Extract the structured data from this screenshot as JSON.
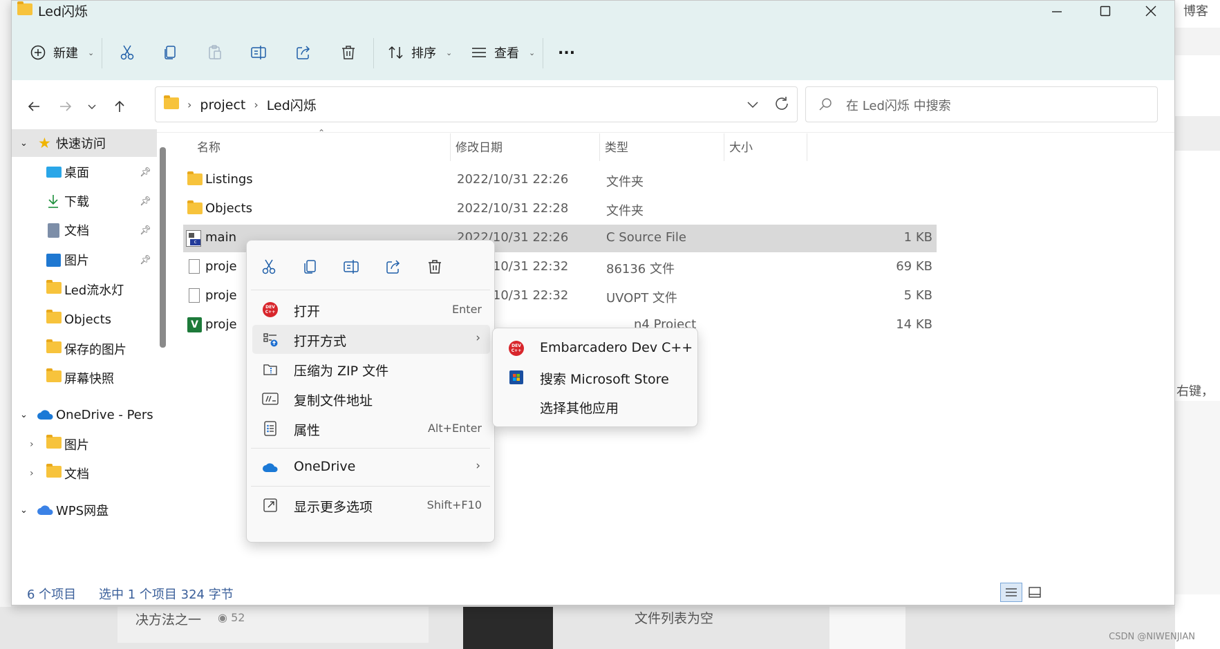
{
  "window": {
    "title": "Led闪烁"
  },
  "toolbar": {
    "new_label": "新建",
    "sort_label": "排序",
    "view_label": "查看",
    "more_label": "..."
  },
  "address": {
    "crumbs": [
      "project",
      "Led闪烁"
    ],
    "search_placeholder": "在 Led闪烁 中搜索"
  },
  "sidebar": {
    "quick_access": "快速访问",
    "items": [
      "桌面",
      "下载",
      "文档",
      "图片",
      "Led流水灯",
      "Objects",
      "保存的图片",
      "屏幕快照"
    ],
    "onedrive": "OneDrive - Pers",
    "onedrive_children": [
      "图片",
      "文档"
    ],
    "wps": "WPS网盘"
  },
  "columns": {
    "name": "名称",
    "date": "修改日期",
    "type": "类型",
    "size": "大小"
  },
  "files": [
    {
      "name": "Listings",
      "date": "2022/10/31 22:26",
      "type": "文件夹",
      "size": ""
    },
    {
      "name": "Objects",
      "date": "2022/10/31 22:28",
      "type": "文件夹",
      "size": ""
    },
    {
      "name": "main",
      "date": "2022/10/31 22:26",
      "type": "C Source File",
      "size": "1 KB"
    },
    {
      "name": "proje",
      "date": "2022/10/31 22:32",
      "type": "86136 文件",
      "size": "69 KB"
    },
    {
      "name": "proje",
      "date": "2022/10/31 22:32",
      "type": "UVOPT 文件",
      "size": "5 KB"
    },
    {
      "name": "proje",
      "date": "",
      "type": "n4 Project",
      "size": "14 KB"
    }
  ],
  "status": {
    "count": "6 个项目",
    "selection": "选中 1 个项目  324 字节"
  },
  "context_menu": {
    "items": [
      {
        "label": "打开",
        "shortcut": "Enter"
      },
      {
        "label": "打开方式",
        "shortcut": ""
      },
      {
        "label": "压缩为 ZIP 文件",
        "shortcut": ""
      },
      {
        "label": "复制文件地址",
        "shortcut": ""
      },
      {
        "label": "属性",
        "shortcut": "Alt+Enter"
      },
      {
        "label": "OneDrive",
        "shortcut": ""
      },
      {
        "label": "显示更多选项",
        "shortcut": "Shift+F10"
      }
    ]
  },
  "submenu": {
    "items": [
      "Embarcadero Dev C++",
      "搜索 Microsoft Store",
      "选择其他应用"
    ]
  },
  "background": {
    "right_label_1": "博客",
    "right_label_2": "右键，",
    "bottom_text_1": "决方法之一",
    "bottom_count": "52",
    "bottom_text_2": "文件列表为空",
    "watermark": "CSDN @NIWENJIAN"
  },
  "colors": {
    "ribbon": "#e4f1f1",
    "status_text": "#3a5f9a",
    "folder": "#f7c33c",
    "onedrive": "#1b79d6"
  }
}
